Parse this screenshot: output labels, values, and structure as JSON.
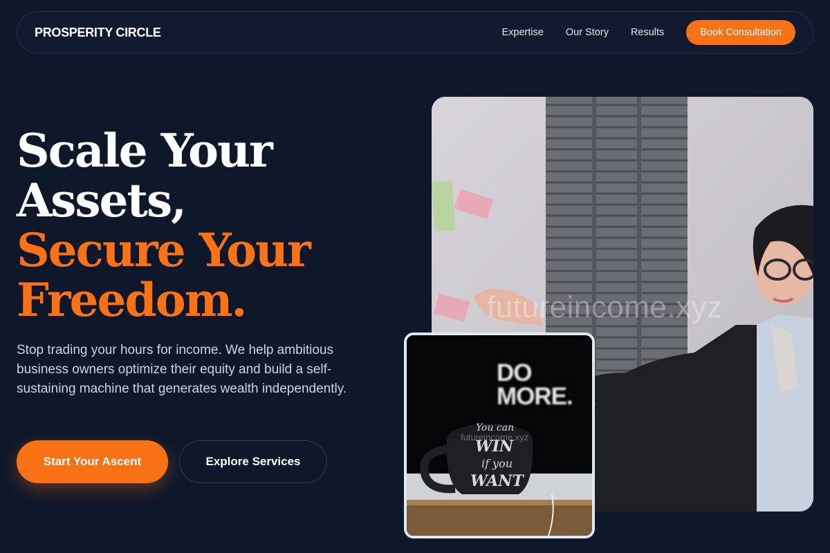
{
  "nav": {
    "brand": "PROSPERITY CIRCLE",
    "links": [
      "Expertise",
      "Our Story",
      "Results"
    ],
    "cta": "Book Consultation"
  },
  "hero": {
    "headline_line1": "Scale Your",
    "headline_line2": "Assets,",
    "headline_line3": "Secure Your",
    "headline_line4": "Freedom.",
    "subtext": "Stop trading your hours for income. We help ambitious business owners optimize their equity and build a self-sustaining machine that generates wealth independently.",
    "primary_button": "Start Your Ascent",
    "secondary_button": "Explore Services"
  },
  "images": {
    "main_watermark": "futureincome.xyz",
    "small_watermark": "futureincome.xyz",
    "poster_line1": "DO",
    "poster_line2": "MORE.",
    "mug_line1": "You can",
    "mug_line2": "WIN",
    "mug_line3": "if you",
    "mug_line4": "WANT"
  },
  "colors": {
    "background": "#0f172a",
    "accent": "#f97316",
    "text": "#ffffff",
    "muted": "#cbd5e1"
  }
}
